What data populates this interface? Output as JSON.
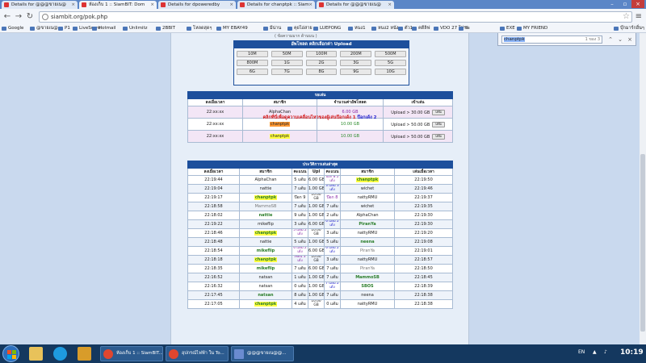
{
  "tabs": [
    {
      "label": "Details for @@@ขายเน@"
    },
    {
      "label": "ห้องเก็บ 1 :: SiamBIT: Dom"
    },
    {
      "label": "Details for dpoweredby"
    },
    {
      "label": "Details for chanptpk :: Siam"
    },
    {
      "label": "Details for @@@ขายเน@"
    }
  ],
  "address": {
    "url": "siambit.org/pok.php"
  },
  "bookmarks": [
    "Google",
    "@ขายเน@",
    "P1",
    "LiveScore",
    "Hotmail",
    "Unlimitz",
    "2BBIT",
    "โหลดสุดๆ",
    "MY EBAY49",
    "มีน่าน",
    "คุยไอ่สาย",
    "LUEPONG",
    "หนง1",
    "หนง2 หนัง",
    "ตัว1",
    "คดีลิฟ",
    "VDO 27 โปรด",
    "ระ",
    "EXE",
    "MY FRIEND",
    "บุ๊กมาร์กอื่นๆ"
  ],
  "find": {
    "query": "chanptpk",
    "count": "1 ของ 3"
  },
  "header_strip": "( ข้อความมาก ด้านบน )",
  "upload": {
    "title": "อัพโหลด คลิกเลือกค่า Upload",
    "options": [
      "10M",
      "50M",
      "100M",
      "200M",
      "500M",
      "800M",
      "1G",
      "2G",
      "3G",
      "5G",
      "6G",
      "7G",
      "8G",
      "9G",
      "10G"
    ]
  },
  "waiting": {
    "title": "รอเล่น",
    "headers": [
      "ลงเมื่อเวลา",
      "สมาชิก",
      "จำนวนค่าอัพโหลด",
      "เข้าเล่น"
    ],
    "rows": [
      {
        "time": "22:xx:xx",
        "member": "AlphaChan",
        "amount": "6.00 GB",
        "play": "Upload > 30.00 GB",
        "btn": "เล่น"
      },
      {
        "time": "22:xx:xx",
        "member": "chanptpk",
        "amount": "10.00 GB",
        "play": "Upload > 50.00 GB",
        "btn": "เล่น"
      },
      {
        "time": "22:xx:xx",
        "member": "chanptpk",
        "amount": "10.00 GB",
        "play": "Upload > 50.00 GB",
        "btn": "เล่น"
      }
    ]
  },
  "notice": {
    "text": "คลิกที่นี่เพื่อดูความเคลื่อนไหวของผู้เล่นป๊อกเด้ง 1",
    "link1": "ป๊อกเด้ง 2",
    "num": "1"
  },
  "history": {
    "title": "ประวัติการเล่นล่าสุด",
    "headers": [
      "ลงเมื่อเวลา",
      "สมาชิก",
      "คะแนน",
      "Upl",
      "คะแนน",
      "สมาชิก",
      "เล่นเมื่อเวลา"
    ],
    "rows": [
      [
        "22:19:44",
        "AlphaChan",
        "5 แต้ม",
        "6.00 GB",
        "ป๊อก 8 2 เด้ง",
        "chanptpk",
        "22:19:50"
      ],
      [
        "22:19:04",
        "nattie",
        "7 แต้ม",
        "1.00 GB",
        "3 แต้ม 3 เด้ง",
        "wichet",
        "22:19:46"
      ],
      [
        "22:19:17",
        "chanptpk",
        "ป๊อก 9",
        "10.00 GB",
        "ป๊อก 8",
        "nattyRMU",
        "22:19:37"
      ],
      [
        "22:18:58",
        "MammoSB",
        "7 แต้ม",
        "1.00 GB",
        "7 แต้ม",
        "wichet",
        "22:19:35"
      ],
      [
        "22:18:02",
        "nattie",
        "9 แต้ม",
        "1.00 GB",
        "2 แต้ม",
        "AlphaChan",
        "22:19:30"
      ],
      [
        "22:19:22",
        "mikeflip",
        "3 แต้ม",
        "6.00 GB",
        "6 แต้ม 2 เด้ง",
        "PiranYa",
        "22:19:30"
      ],
      [
        "22:18:46",
        "chanptpk",
        "5 แต้ม 2 เด้ง",
        "10.00 GB",
        "3 แต้ม",
        "nattyRMU",
        "22:19:20"
      ],
      [
        "22:18:48",
        "nattie",
        "5 แต้ม",
        "1.00 GB",
        "5 แต้ม",
        "neena",
        "22:19:08"
      ],
      [
        "22:18:54",
        "mikeflip",
        "6 แต้ม 2 เด้ง",
        "6.00 GB",
        "6 แต้ม 2 เด้ง",
        "PiranYa",
        "22:19:01"
      ],
      [
        "22:18:18",
        "chanptpk",
        "เซียน 3 เด้ง",
        "10.00 GB",
        "3 แต้ม",
        "nattyRMU",
        "22:18:57"
      ],
      [
        "22:18:35",
        "mikeflip",
        "7 แต้ม",
        "6.00 GB",
        "7 แต้ม",
        "PiranYa",
        "22:18:50"
      ],
      [
        "22:16:52",
        "natsan",
        "1 แต้ม",
        "1.00 GB",
        "7 แต้ม",
        "MammoSB",
        "22:18:45"
      ],
      [
        "22:16:32",
        "natsan",
        "0 แต้ม",
        "1.00 GB",
        "7 แต้ม 2 เด้ง",
        "SBOS",
        "22:18:39"
      ],
      [
        "22:17:45",
        "natsan",
        "8 แต้ม",
        "1.00 GB",
        "7 แต้ม",
        "neena",
        "22:18:38"
      ],
      [
        "22:17:05",
        "chanptpk",
        "4 แต้ม",
        "10.00 GB",
        "0 แต้ม",
        "nattyRMU",
        "22:18:38"
      ]
    ]
  },
  "taskbar": {
    "items": [
      "ห้องเก็บ 1 :: SiamBIT...",
      "อุปกรณ์ไฟฟ้า ใน To...",
      "@@@ขายเน@@..."
    ],
    "lang": "EN",
    "time": "10:19"
  },
  "colors": {
    "accent": "#1d4f9c",
    "highlight_user": "#ff9933",
    "find_highlight": "#ffff40",
    "notice": "#d41a1a"
  }
}
